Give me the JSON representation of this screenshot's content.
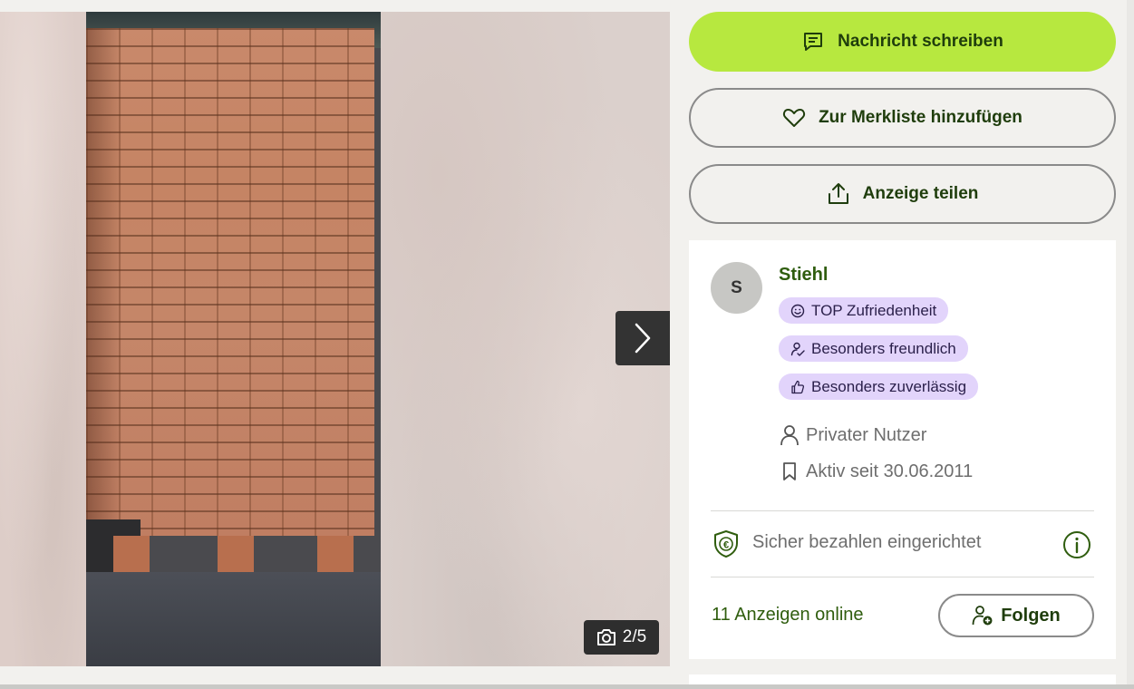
{
  "gallery": {
    "counter": "2/5",
    "camera_icon": "camera-icon",
    "next_icon": "chevron-right-icon"
  },
  "actions": {
    "message_label": "Nachricht schreiben",
    "favorite_label": "Zur Merkliste hinzufügen",
    "share_label": "Anzeige teilen"
  },
  "seller": {
    "avatar_initial": "S",
    "name": "Stiehl",
    "badges": [
      {
        "label": "TOP Zufriedenheit",
        "icon": "smiley-icon"
      },
      {
        "label": "Besonders freundlich",
        "icon": "friendly-icon"
      },
      {
        "label": "Besonders zuverlässig",
        "icon": "thumbs-up-icon"
      }
    ],
    "user_type": "Privater Nutzer",
    "active_since": "Aktiv seit 30.06.2011",
    "secure_payment": "Sicher bezahlen eingerichtet",
    "ads_online": "11 Anzeigen online",
    "follow_label": "Folgen"
  },
  "colors": {
    "primary": "#b7e83f",
    "brand_text": "#2f5d0e",
    "badge_bg": "#e2d4fb"
  }
}
